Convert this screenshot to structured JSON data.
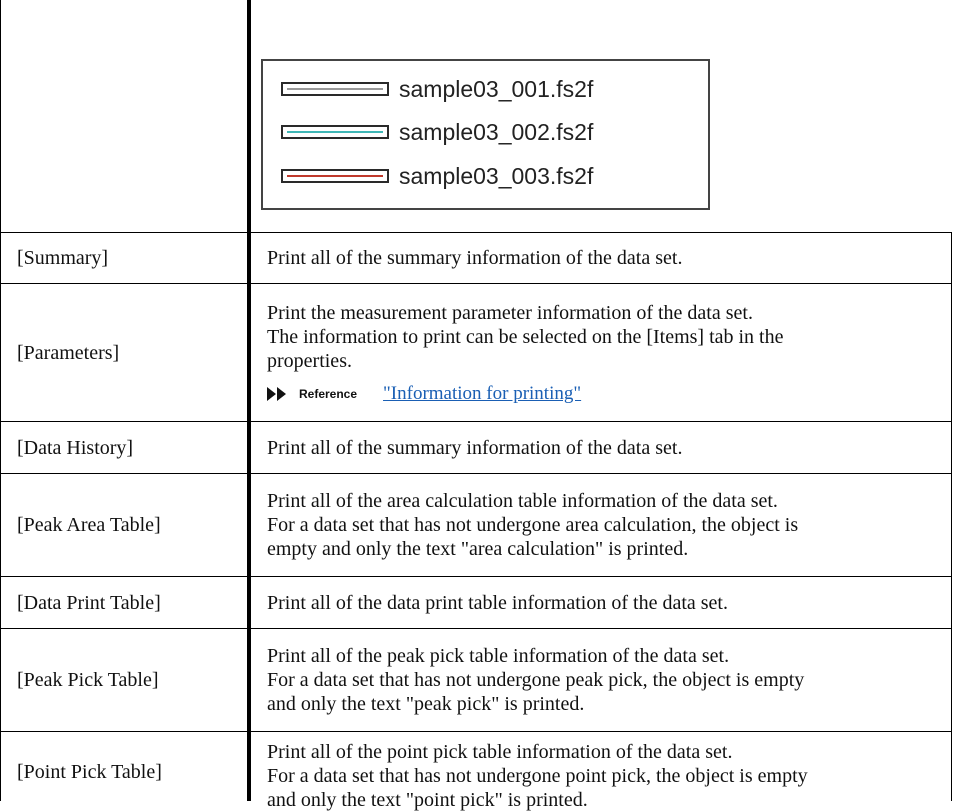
{
  "legend": {
    "items": [
      {
        "label": "sample03_001.fs2f",
        "color": "#9a9a9a"
      },
      {
        "label": "sample03_002.fs2f",
        "color": "#3fb7b7"
      },
      {
        "label": "sample03_003.fs2f",
        "color": "#c0392b"
      }
    ]
  },
  "rows": [
    {
      "name": "[Summary]",
      "lines": [
        "Print all of the summary information of the data set."
      ]
    },
    {
      "name": "[Parameters]",
      "lines": [
        "Print the measurement parameter information of the data set.",
        "The information to print can be selected on the [Items] tab in the",
        "properties."
      ],
      "ref_label": "Reference",
      "ref_link": "\"Information for printing\""
    },
    {
      "name": "[Data History]",
      "lines": [
        "Print all of the summary information of the data set."
      ]
    },
    {
      "name": "[Peak Area Table]",
      "lines": [
        "Print all of the area calculation table information of the data set.",
        "For a data set that has not undergone area calculation, the object is",
        "empty and only the text \"area calculation\" is printed."
      ]
    },
    {
      "name": "[Data Print Table]",
      "lines": [
        "Print all of the data print table information of the data set."
      ]
    },
    {
      "name": "[Peak Pick Table]",
      "lines": [
        "Print all of the peak pick table information of the data set.",
        "For a data set that has not undergone peak pick, the object is empty",
        "and only the text \"peak pick\" is printed."
      ]
    },
    {
      "name": "[Point Pick Table]",
      "lines": [
        "Print all of the point pick table information of the data set.",
        "For a data set that has not undergone point pick, the object is empty",
        "and only the text \"point pick\" is printed."
      ]
    }
  ]
}
